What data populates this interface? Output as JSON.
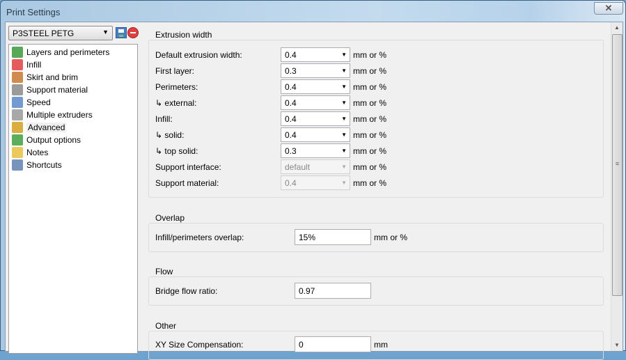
{
  "window": {
    "title": "Print Settings",
    "close_glyph": "✕"
  },
  "preset": {
    "selected": "P3STEEL PETG"
  },
  "tree": [
    {
      "label": "Layers and perimeters",
      "icon": "layers-icon",
      "color": "#3a9a3a"
    },
    {
      "label": "Infill",
      "icon": "infill-icon",
      "color": "#e04040"
    },
    {
      "label": "Skirt and brim",
      "icon": "skirt-icon",
      "color": "#c87830"
    },
    {
      "label": "Support material",
      "icon": "support-icon",
      "color": "#8a8a8a"
    },
    {
      "label": "Speed",
      "icon": "speed-icon",
      "color": "#5a8ac8"
    },
    {
      "label": "Multiple extruders",
      "icon": "funnel-icon",
      "color": "#999999"
    },
    {
      "label": "Advanced",
      "icon": "wand-icon",
      "color": "#d4a020"
    },
    {
      "label": "Output options",
      "icon": "output-icon",
      "color": "#40a040"
    },
    {
      "label": "Notes",
      "icon": "note-icon",
      "color": "#e8c040"
    },
    {
      "label": "Shortcuts",
      "icon": "wrench-icon",
      "color": "#6080b0"
    }
  ],
  "extrusion": {
    "title": "Extrusion width",
    "unit": "mm or %",
    "rows": [
      {
        "label": "Default extrusion width:",
        "value": "0.4",
        "disabled": false
      },
      {
        "label": "First layer:",
        "value": "0.3",
        "disabled": false
      },
      {
        "label": "Perimeters:",
        "value": "0.4",
        "disabled": false
      },
      {
        "label": "↳ external:",
        "value": "0.4",
        "disabled": false
      },
      {
        "label": "Infill:",
        "value": "0.4",
        "disabled": false
      },
      {
        "label": "↳ solid:",
        "value": "0.4",
        "disabled": false
      },
      {
        "label": "↳ top solid:",
        "value": "0.3",
        "disabled": false
      },
      {
        "label": "Support interface:",
        "value": "default",
        "disabled": true
      },
      {
        "label": "Support material:",
        "value": "0.4",
        "disabled": true
      }
    ]
  },
  "overlap": {
    "title": "Overlap",
    "label": "Infill/perimeters overlap:",
    "value": "15%",
    "unit": "mm or %"
  },
  "flow": {
    "title": "Flow",
    "label": "Bridge flow ratio:",
    "value": "0.97"
  },
  "other": {
    "title": "Other",
    "label": "XY Size Compensation:",
    "value": "0",
    "unit": "mm"
  }
}
